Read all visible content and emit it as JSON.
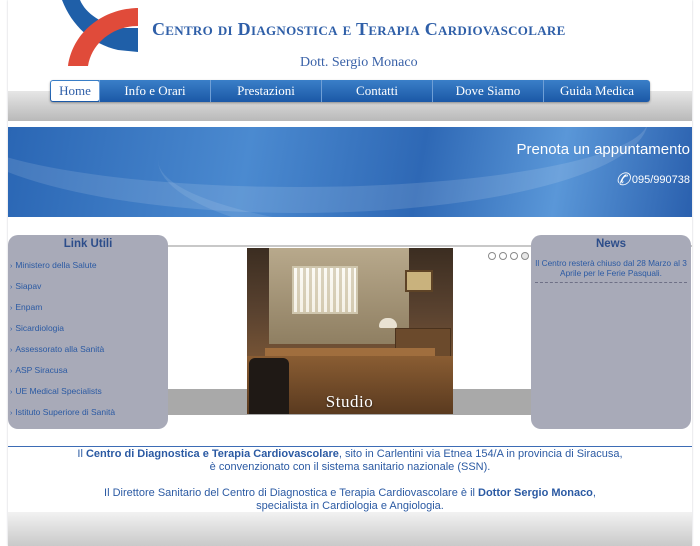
{
  "header": {
    "title": "Centro di Diagnostica e Terapia Cardiovascolare",
    "subtitle": "Dott. Sergio Monaco"
  },
  "colors": {
    "brand_blue": "#2f5fa8",
    "logo_red": "#e04b3a",
    "nav_blue": "#1f5fa8",
    "panel_gray": "#a8aab8"
  },
  "nav": {
    "items": [
      {
        "label": "Home"
      },
      {
        "label": "Info e Orari"
      },
      {
        "label": "Prestazioni"
      },
      {
        "label": "Contatti"
      },
      {
        "label": "Dove Siamo"
      },
      {
        "label": "Guida Medica"
      }
    ],
    "active_index": 0
  },
  "banner": {
    "cta": "Prenota un appuntamento",
    "phone_icon": "phone-icon",
    "phone": "095/990738"
  },
  "links_panel": {
    "title": "Link Utili",
    "items": [
      "Ministero della Salute",
      "Siapav",
      "Enpam",
      "Sicardiologia",
      "Assessorato alla Sanità",
      "ASP Siracusa",
      "UE Medical Specialists",
      "Istituto Superiore di Sanità"
    ]
  },
  "news_panel": {
    "title": "News",
    "items": [
      "Il Centro resterà chiuso dal 28 Marzo al 3 Aprile per le Ferie Pasquali."
    ]
  },
  "slideshow": {
    "caption": "Studio",
    "slide_count": 4,
    "active_slide": 4
  },
  "intro": {
    "p1_prefix": "Il ",
    "p1_strong": "Centro di Diagnostica e Terapia Cardiovascolare",
    "p1_suffix": ", sito in Carlentini via Etnea 154/A in provincia di Siracusa,",
    "p1_line2": "è convenzionato con il sistema sanitario nazionale (SSN).",
    "p2_prefix": "Il Direttore Sanitario del Centro di Diagnostica e Terapia Cardiovascolare è il ",
    "p2_strong": "Dottor Sergio Monaco",
    "p2_suffix": ",",
    "p2_line2": "specialista in Cardiologia e Angiologia."
  }
}
